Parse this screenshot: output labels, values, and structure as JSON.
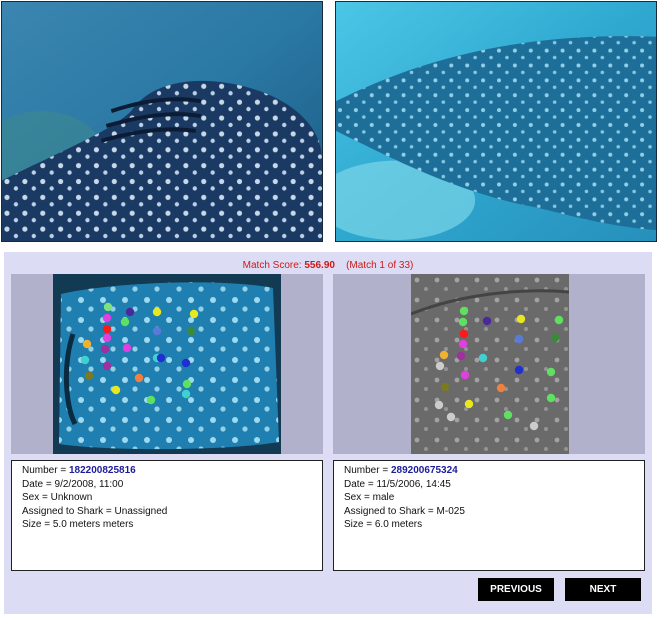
{
  "match": {
    "prefix": "Match Score:",
    "score": "556.90",
    "position": "(Match 1 of 33)"
  },
  "left": {
    "photo_icon": "whale-shark-photo",
    "number_label": "Number =",
    "number": "182200825816",
    "date": "Date = 9/2/2008, 11:00",
    "sex": "Sex = Unknown",
    "assigned": "Assigned to Shark = Unassigned",
    "size": "Size = 5.0 meters meters"
  },
  "right": {
    "photo_icon": "whale-shark-photo",
    "number_label": "Number =",
    "number": "289200675324",
    "date": "Date = 11/5/2006, 14:45",
    "sex": "Sex = male",
    "assigned": "Assigned to Shark = M-025",
    "size": "Size = 6.0 meters"
  },
  "nav": {
    "previous": "PREVIOUS",
    "next": "NEXT"
  },
  "colors": {
    "panel_bg": "#dcdcf5",
    "match_text": "#d01818",
    "number_text": "#1c1c9a",
    "button_bg": "#000000"
  }
}
